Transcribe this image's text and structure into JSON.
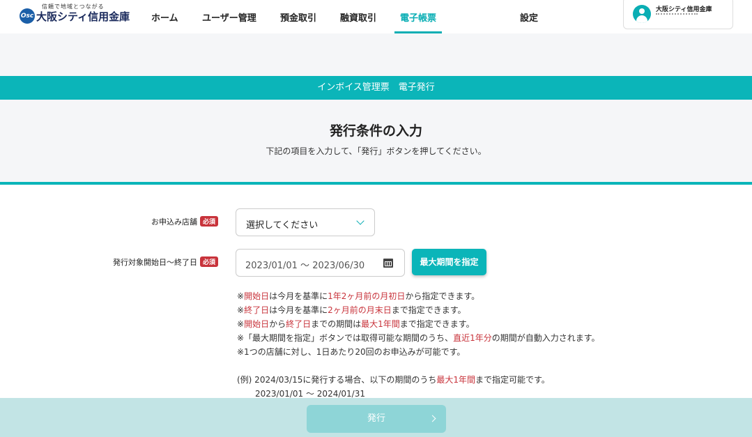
{
  "logo": {
    "tagline": "信頼で地域とつながる",
    "mark": "Osc",
    "name": "大阪シティ信用金庫"
  },
  "nav": {
    "items": [
      {
        "label": "ホーム"
      },
      {
        "label": "ユーザー管理"
      },
      {
        "label": "預金取引"
      },
      {
        "label": "融資取引"
      },
      {
        "label": "電子帳票"
      },
      {
        "label": "設定"
      }
    ]
  },
  "user": {
    "org": "大阪シティ信用金庫"
  },
  "banner": {
    "title": "インボイス管理票　電子発行"
  },
  "intro": {
    "title": "発行条件の入力",
    "description": "下記の項目を入力して、「発行」ボタンを押してください。"
  },
  "form": {
    "store": {
      "label": "お申込み店舗",
      "badge": "必須",
      "value": "選択してください"
    },
    "period": {
      "label": "発行対象開始日～終了日",
      "badge": "必須",
      "value": "2023/01/01 ～ 2023/06/30"
    },
    "max_button": "最大期間を指定"
  },
  "notes": {
    "line1": {
      "a": "※",
      "b": "開始日",
      "c": "は今月を基準に",
      "d": "1年2ヶ月前の月初日",
      "e": "から指定できます。"
    },
    "line2": {
      "a": "※",
      "b": "終了日",
      "c": "は今月を基準に",
      "d": "2ヶ月前の月末日",
      "e": "まで指定できます。"
    },
    "line3": {
      "a": "※",
      "b": "開始日",
      "c": "から",
      "d": "終了日",
      "e": "までの期間は",
      "f": "最大1年間",
      "g": "まで指定できます。"
    },
    "line4": {
      "a": "※「最大期間を指定」ボタンでは取得可能な期間のうち、",
      "b": "直近1年分",
      "c": "の期間が自動入力されます。"
    },
    "line5": "※1つの店舗に対し、1日あたり20回のお申込みが可能です。"
  },
  "example": {
    "prefix": "(例)  2024/03/15に発行する場合、以下の期間のうち",
    "highlight": "最大1年間",
    "suffix": "まで指定可能です。",
    "range": "2023/01/01 ～ 2024/01/31"
  },
  "footer": {
    "submit_label": "発行"
  },
  "colors": {
    "accent": "#0bb5b9",
    "required": "#c8333b",
    "disabled_button": "#8ed5d7",
    "footer_bg": "#c2e4e5"
  }
}
